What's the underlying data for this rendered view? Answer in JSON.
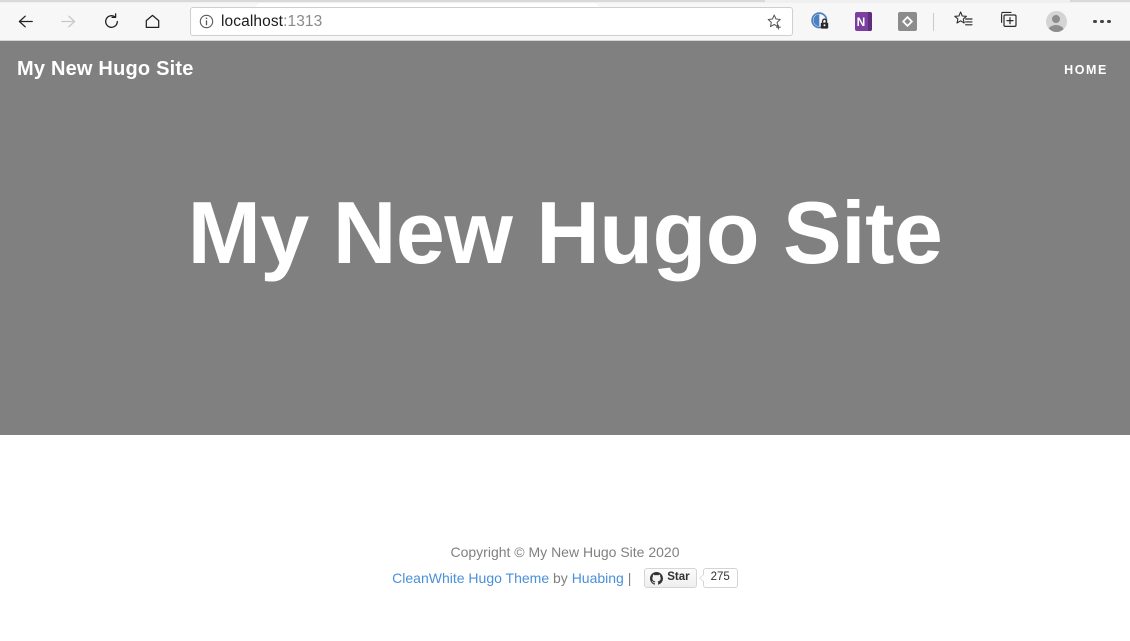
{
  "browser": {
    "nav": {
      "back_label": "Back",
      "forward_label": "Forward",
      "reload_label": "Refresh",
      "home_label": "Home"
    },
    "address": {
      "info_icon": "info-icon",
      "url_host": "localhost",
      "url_port": ":1313",
      "favorite_icon": "add-favorite-star-icon"
    },
    "toolbar": {
      "extensions": [
        {
          "name": "brave-shields-icon",
          "label": ""
        },
        {
          "name": "onenote-extension-icon",
          "label": "N"
        },
        {
          "name": "diamond-extension-icon",
          "label": ""
        }
      ],
      "favorites_label": "Favorites",
      "collections_label": "Collections",
      "profile_label": "Profile",
      "settings_label": "Settings and more"
    }
  },
  "site": {
    "brand": "My New Hugo Site",
    "nav_links": [
      {
        "label": "HOME",
        "name": "site-nav-link-home"
      }
    ],
    "hero_title": "My New Hugo Site",
    "hero_bg_color": "#808080",
    "footer": {
      "copyright": "Copyright © My New Hugo Site 2020",
      "theme_link": "CleanWhite Hugo Theme",
      "by_text": " by ",
      "author_link": "Huabing",
      "separator": " | ",
      "github_star_label": "Star",
      "github_star_count": "275",
      "link_color": "#4a90d9",
      "text_color": "#808080"
    }
  }
}
